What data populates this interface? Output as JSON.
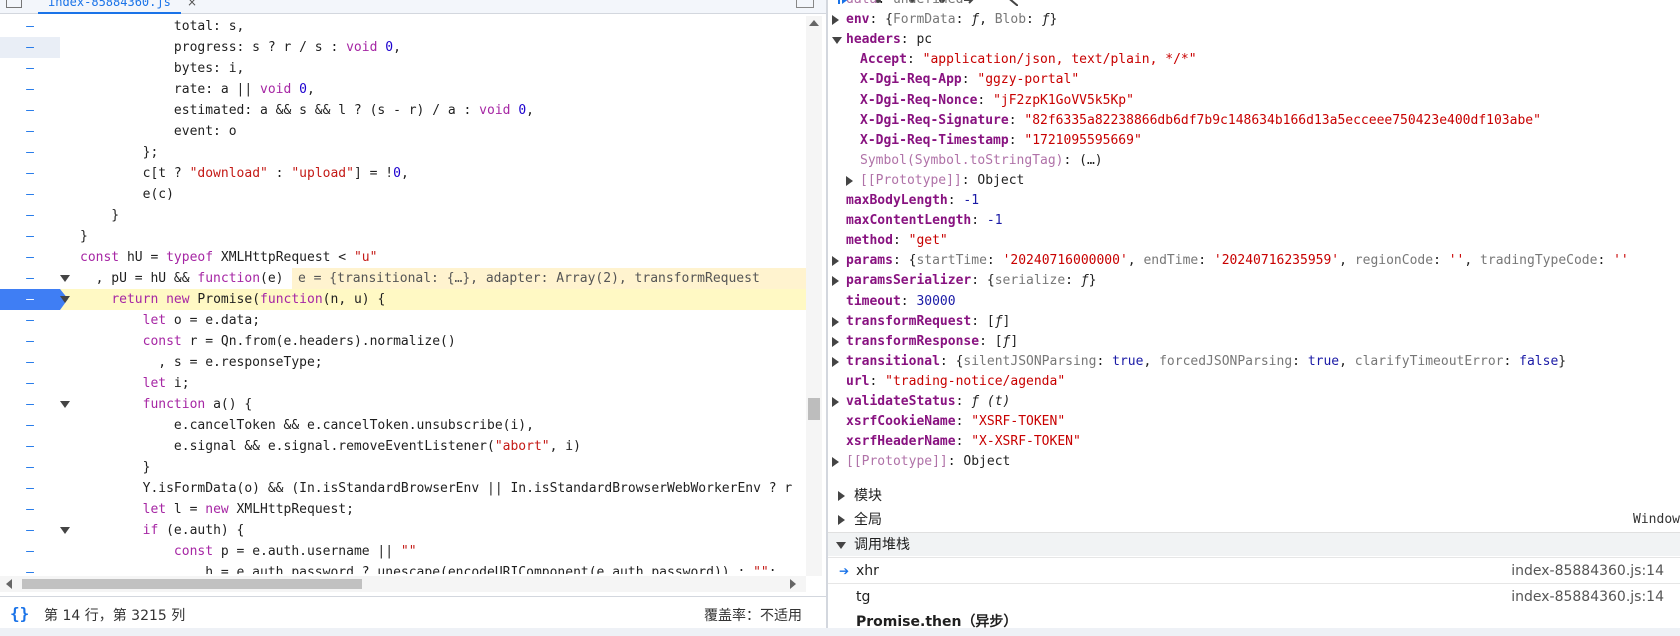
{
  "editor": {
    "tab_label": "index-85884360.js",
    "tab_close": "×",
    "status_position": "第 14 行，第 3215 列",
    "status_braces": "{}",
    "coverage": "覆盖率：不适用",
    "lines": [
      {
        "g": "–",
        "parts": [
          [
            "",
            "            total: s,"
          ]
        ]
      },
      {
        "g": "–",
        "hl": true,
        "parts": [
          [
            "",
            "            progress: s ? r / s : "
          ],
          [
            "kw",
            "void"
          ],
          [
            "",
            " "
          ],
          [
            "num",
            "0"
          ],
          [
            "",
            ","
          ]
        ]
      },
      {
        "g": "–",
        "parts": [
          [
            "",
            "            bytes: i,"
          ]
        ]
      },
      {
        "g": "–",
        "parts": [
          [
            "",
            "            rate: a || "
          ],
          [
            "kw",
            "void"
          ],
          [
            "",
            " "
          ],
          [
            "num",
            "0"
          ],
          [
            "",
            ","
          ]
        ]
      },
      {
        "g": "–",
        "parts": [
          [
            "",
            "            estimated: a && s && l ? (s - r) / a : "
          ],
          [
            "kw",
            "void"
          ],
          [
            "",
            " "
          ],
          [
            "num",
            "0"
          ],
          [
            "",
            ","
          ]
        ]
      },
      {
        "g": "–",
        "parts": [
          [
            "",
            "            event: o"
          ]
        ]
      },
      {
        "g": "–",
        "parts": [
          [
            "",
            "        };"
          ]
        ]
      },
      {
        "g": "–",
        "parts": [
          [
            "",
            "        c[t ? "
          ],
          [
            "str",
            "\"download\""
          ],
          [
            "",
            " : "
          ],
          [
            "str",
            "\"upload\""
          ],
          [
            "",
            "] = !"
          ],
          [
            "num",
            "0"
          ],
          [
            "",
            ","
          ]
        ]
      },
      {
        "g": "–",
        "parts": [
          [
            "",
            "        e(c)"
          ]
        ]
      },
      {
        "g": "–",
        "parts": [
          [
            "",
            "    }"
          ]
        ]
      },
      {
        "g": "–",
        "parts": [
          [
            "",
            "}"
          ]
        ]
      },
      {
        "g": "–",
        "parts": [
          [
            "kw",
            "const"
          ],
          [
            "",
            " hU = "
          ],
          [
            "kw",
            "typeof"
          ],
          [
            "",
            " XMLHttpRequest < "
          ],
          [
            "str",
            "\"u\""
          ]
        ]
      },
      {
        "g": "–",
        "fold": true,
        "parts": [
          [
            "",
            "  , pU = hU && "
          ],
          [
            "kw",
            "function"
          ],
          [
            "",
            "(e) {"
          ]
        ],
        "inline": "e = {transitional: {…}, adapter: Array(2), transformRequest"
      },
      {
        "g": "–",
        "fold": true,
        "paused": true,
        "bp": true,
        "parts": [
          [
            "",
            "    "
          ],
          [
            "kw",
            "return"
          ],
          [
            "",
            " "
          ],
          [
            "kw",
            "new"
          ],
          [
            "",
            " Promise("
          ],
          [
            "kw",
            "function"
          ],
          [
            "",
            "(n, u) {"
          ]
        ]
      },
      {
        "g": "–",
        "parts": [
          [
            "",
            "        "
          ],
          [
            "kw",
            "let"
          ],
          [
            "",
            " o = e.data;"
          ]
        ]
      },
      {
        "g": "–",
        "parts": [
          [
            "",
            "        "
          ],
          [
            "kw",
            "const"
          ],
          [
            "",
            " r = Qn.from(e.headers).normalize()"
          ]
        ]
      },
      {
        "g": "–",
        "parts": [
          [
            "",
            "          , s = e.responseType;"
          ]
        ]
      },
      {
        "g": "–",
        "parts": [
          [
            "",
            "        "
          ],
          [
            "kw",
            "let"
          ],
          [
            "",
            " i;"
          ]
        ]
      },
      {
        "g": "–",
        "fold": true,
        "parts": [
          [
            "",
            "        "
          ],
          [
            "kw",
            "function"
          ],
          [
            "",
            " a() {"
          ]
        ]
      },
      {
        "g": "–",
        "parts": [
          [
            "",
            "            e.cancelToken && e.cancelToken.unsubscribe(i),"
          ]
        ]
      },
      {
        "g": "–",
        "parts": [
          [
            "",
            "            e.signal && e.signal.removeEventListener("
          ],
          [
            "str",
            "\"abort\""
          ],
          [
            "",
            ", i)"
          ]
        ]
      },
      {
        "g": "–",
        "parts": [
          [
            "",
            "        }"
          ]
        ]
      },
      {
        "g": "–",
        "parts": [
          [
            "",
            "        Y.isFormData(o) && (In.isStandardBrowserEnv || In.isStandardBrowserWebWorkerEnv ? r"
          ]
        ]
      },
      {
        "g": "–",
        "parts": [
          [
            "",
            "        "
          ],
          [
            "kw",
            "let"
          ],
          [
            "",
            " l = "
          ],
          [
            "kw",
            "new"
          ],
          [
            "",
            " XMLHttpRequest;"
          ]
        ]
      },
      {
        "g": "–",
        "fold": true,
        "parts": [
          [
            "",
            "        "
          ],
          [
            "kw",
            "if"
          ],
          [
            "",
            " (e.auth) {"
          ]
        ]
      },
      {
        "g": "–",
        "parts": [
          [
            "",
            "            "
          ],
          [
            "kw",
            "const"
          ],
          [
            "",
            " p = e.auth.username || "
          ],
          [
            "str",
            "\"\""
          ]
        ]
      },
      {
        "g": "–",
        "parts": [
          [
            "",
            "              , h = e.auth.password ? unescape(encodeURIComponent(e.auth.password)) : "
          ],
          [
            "str",
            "\"\""
          ],
          [
            "",
            ";"
          ]
        ]
      }
    ]
  },
  "scope": {
    "props": [
      {
        "indent": 1,
        "tri": "",
        "key": "data",
        "dim": true,
        "val": [
          [
            "v-dim",
            "undefined"
          ]
        ]
      },
      {
        "indent": 1,
        "tri": "r",
        "key": "env",
        "val": [
          [
            "v-obj",
            "{"
          ],
          [
            "v-dim",
            "FormData"
          ],
          [
            "v-obj",
            ": "
          ],
          [
            "v-fn",
            "ƒ"
          ],
          [
            "v-obj",
            ", "
          ],
          [
            "v-dim",
            "Blob"
          ],
          [
            "v-obj",
            ": "
          ],
          [
            "v-fn",
            "ƒ"
          ],
          [
            "v-obj",
            "}"
          ]
        ]
      },
      {
        "indent": 1,
        "tri": "d",
        "key": "headers",
        "val": [
          [
            "v-obj",
            "pc"
          ]
        ]
      },
      {
        "indent": 2,
        "tri": "",
        "key": "Accept",
        "val": [
          [
            "v-str",
            "\"application/json, text/plain, */*\""
          ]
        ]
      },
      {
        "indent": 2,
        "tri": "",
        "key": "X-Dgi-Req-App",
        "val": [
          [
            "v-str",
            "\"ggzy-portal\""
          ]
        ]
      },
      {
        "indent": 2,
        "tri": "",
        "key": "X-Dgi-Req-Nonce",
        "val": [
          [
            "v-str",
            "\"jF2zpK1GoVV5k5Kp\""
          ]
        ]
      },
      {
        "indent": 2,
        "tri": "",
        "key": "X-Dgi-Req-Signature",
        "val": [
          [
            "v-str",
            "\"82f6335a82238866db6df7b9c148634b166d13a5ecceee750423e400df103abe\""
          ]
        ]
      },
      {
        "indent": 2,
        "tri": "",
        "key": "X-Dgi-Req-Timestamp",
        "val": [
          [
            "v-str",
            "\"1721095595669\""
          ]
        ]
      },
      {
        "indent": 2,
        "tri": "",
        "key": "Symbol(Symbol.toStringTag)",
        "dim": true,
        "val": [
          [
            "v-obj",
            "(…)"
          ]
        ]
      },
      {
        "indent": 2,
        "tri": "r",
        "key": "[[Prototype]]",
        "dim": true,
        "val": [
          [
            "v-obj",
            "Object"
          ]
        ]
      },
      {
        "indent": 1,
        "tri": "",
        "key": "maxBodyLength",
        "val": [
          [
            "v-num",
            "-1"
          ]
        ]
      },
      {
        "indent": 1,
        "tri": "",
        "key": "maxContentLength",
        "val": [
          [
            "v-num",
            "-1"
          ]
        ]
      },
      {
        "indent": 1,
        "tri": "",
        "key": "method",
        "val": [
          [
            "v-str",
            "\"get\""
          ]
        ]
      },
      {
        "indent": 1,
        "tri": "r",
        "key": "params",
        "val": [
          [
            "v-obj",
            "{"
          ],
          [
            "v-dim",
            "startTime"
          ],
          [
            "v-obj",
            ": "
          ],
          [
            "v-str",
            "'20240716000000'"
          ],
          [
            "v-obj",
            ", "
          ],
          [
            "v-dim",
            "endTime"
          ],
          [
            "v-obj",
            ": "
          ],
          [
            "v-str",
            "'20240716235959'"
          ],
          [
            "v-obj",
            ", "
          ],
          [
            "v-dim",
            "regionCode"
          ],
          [
            "v-obj",
            ": "
          ],
          [
            "v-str",
            "''"
          ],
          [
            "v-obj",
            ", "
          ],
          [
            "v-dim",
            "tradingTypeCode"
          ],
          [
            "v-obj",
            ": "
          ],
          [
            "v-str",
            "''"
          ]
        ]
      },
      {
        "indent": 1,
        "tri": "r",
        "key": "paramsSerializer",
        "val": [
          [
            "v-obj",
            "{"
          ],
          [
            "v-dim",
            "serialize"
          ],
          [
            "v-obj",
            ": "
          ],
          [
            "v-fn",
            "ƒ"
          ],
          [
            "v-obj",
            "}"
          ]
        ]
      },
      {
        "indent": 1,
        "tri": "",
        "key": "timeout",
        "val": [
          [
            "v-num",
            "30000"
          ]
        ]
      },
      {
        "indent": 1,
        "tri": "r",
        "key": "transformRequest",
        "val": [
          [
            "v-obj",
            "["
          ],
          [
            "v-fn",
            "ƒ"
          ],
          [
            "v-obj",
            "]"
          ]
        ]
      },
      {
        "indent": 1,
        "tri": "r",
        "key": "transformResponse",
        "val": [
          [
            "v-obj",
            "["
          ],
          [
            "v-fn",
            "ƒ"
          ],
          [
            "v-obj",
            "]"
          ]
        ]
      },
      {
        "indent": 1,
        "tri": "r",
        "key": "transitional",
        "val": [
          [
            "v-obj",
            "{"
          ],
          [
            "v-dim",
            "silentJSONParsing"
          ],
          [
            "v-obj",
            ": "
          ],
          [
            "v-num",
            "true"
          ],
          [
            "v-obj",
            ", "
          ],
          [
            "v-dim",
            "forcedJSONParsing"
          ],
          [
            "v-obj",
            ": "
          ],
          [
            "v-num",
            "true"
          ],
          [
            "v-obj",
            ", "
          ],
          [
            "v-dim",
            "clarifyTimeoutError"
          ],
          [
            "v-obj",
            ": "
          ],
          [
            "v-num",
            "false"
          ],
          [
            "v-obj",
            "}"
          ]
        ]
      },
      {
        "indent": 1,
        "tri": "",
        "key": "url",
        "val": [
          [
            "v-str",
            "\"trading-notice/agenda\""
          ]
        ]
      },
      {
        "indent": 1,
        "tri": "r",
        "key": "validateStatus",
        "val": [
          [
            "v-fn",
            "ƒ (t)"
          ]
        ]
      },
      {
        "indent": 1,
        "tri": "",
        "key": "xsrfCookieName",
        "val": [
          [
            "v-str",
            "\"XSRF-TOKEN\""
          ]
        ]
      },
      {
        "indent": 1,
        "tri": "",
        "key": "xsrfHeaderName",
        "val": [
          [
            "v-str",
            "\"X-XSRF-TOKEN\""
          ]
        ]
      },
      {
        "indent": 1,
        "tri": "r",
        "key": "[[Prototype]]",
        "dim": true,
        "val": [
          [
            "v-obj",
            "Object"
          ]
        ]
      }
    ],
    "module_label": "模块",
    "global_label": "全局",
    "global_value": "Window",
    "callstack_label": "调用堆栈",
    "frames": [
      {
        "name": "xhr",
        "loc": "index-85884360.js:14",
        "current": true
      },
      {
        "name": "tg",
        "loc": "index-85884360.js:14",
        "current": false
      },
      {
        "name": "Promise.then（异步）",
        "loc": "",
        "current": false
      }
    ]
  }
}
